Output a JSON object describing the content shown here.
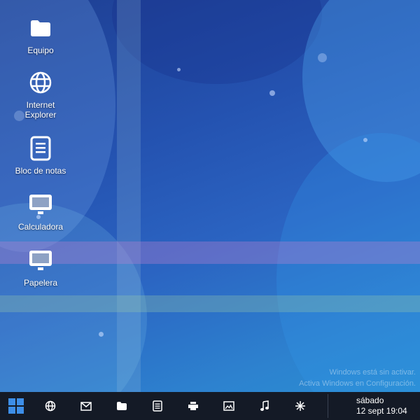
{
  "desktop": {
    "icons": [
      {
        "label": "Equipo",
        "icon": "folder-icon"
      },
      {
        "label": "Internet\nExplorer",
        "icon": "globe-icon"
      },
      {
        "label": "Bloc de notas",
        "icon": "notepad-icon"
      },
      {
        "label": "Calculadora",
        "icon": "monitor-icon"
      },
      {
        "label": "Papelera",
        "icon": "monitor-icon"
      }
    ],
    "watermark": {
      "line1": "Windows está sin activar.",
      "line2": "Activa Windows en Configuración."
    }
  },
  "taskbar": {
    "background": "#141a26",
    "accent": "#3d8ee8",
    "buttons": [
      {
        "icon": "windows-start-icon"
      },
      {
        "icon": "globe-icon"
      },
      {
        "icon": "mail-icon"
      },
      {
        "icon": "folder-icon"
      },
      {
        "icon": "document-icon"
      },
      {
        "icon": "printer-icon"
      },
      {
        "icon": "image-icon"
      },
      {
        "icon": "music-note-icon"
      },
      {
        "icon": "settings-sparkle-icon"
      }
    ],
    "clock": {
      "day": "sábado",
      "datetime": "12 sept 19:04"
    }
  }
}
